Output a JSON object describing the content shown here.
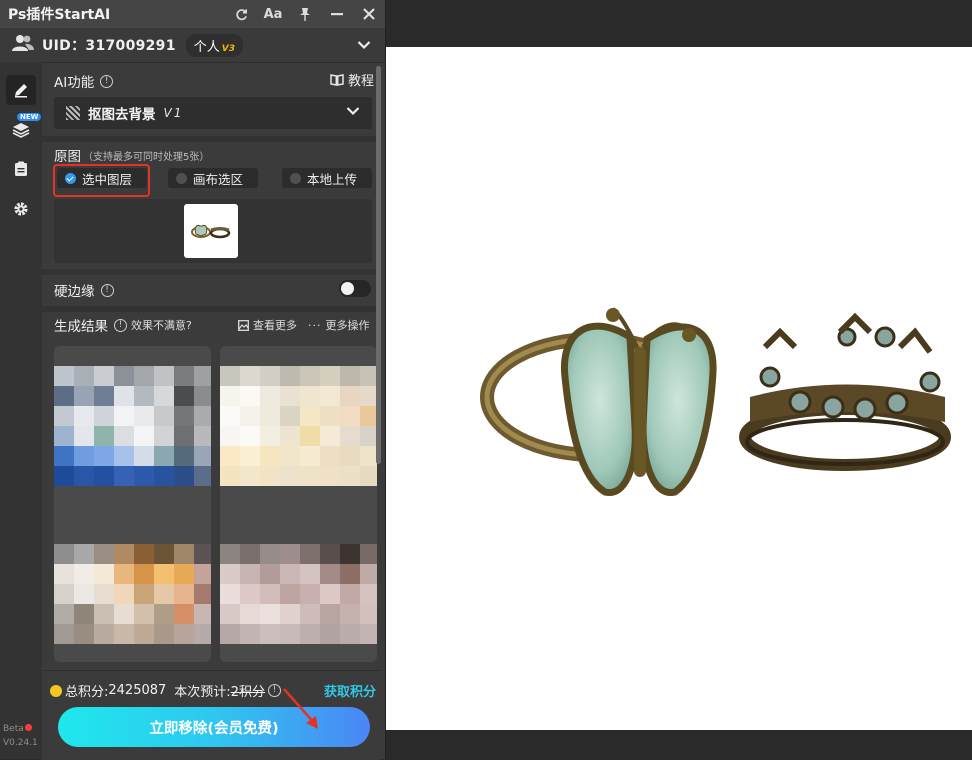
{
  "app": {
    "title": "Ps插件StartAI"
  },
  "titlebar": {
    "icons": [
      "refresh-icon",
      "font-size-icon",
      "pin-icon",
      "minimize-icon",
      "close-icon"
    ],
    "font_label": "Aa"
  },
  "user": {
    "uid": "UID：317009291",
    "plan": "个人",
    "plan_version": "V3"
  },
  "sidebar": {
    "new_tag": "NEW",
    "beta": "Beta",
    "version": "V0.24.1"
  },
  "ai_section": {
    "label": "AI功能",
    "tutorial": "教程",
    "selected_function": "抠图去背景",
    "function_version": "V1"
  },
  "original": {
    "label": "原图",
    "hint": "（支持最多可同时处理5张）",
    "options": [
      "选中图层",
      "画布选区",
      "本地上传"
    ],
    "selected_index": 0
  },
  "hard_edge": {
    "label": "硬边缘",
    "enabled": false
  },
  "results": {
    "label": "生成结果",
    "unsatisfied": "效果不满意?",
    "view_more": "查看更多",
    "more_actions": "更多操作"
  },
  "footer": {
    "total_points_label": "总积分:",
    "total_points": "2425087",
    "estimate_label": "本次预计:",
    "estimate_value": "2积分",
    "get_points": "获取积分",
    "action_button": "立即移除(会员免费)"
  },
  "colors": {
    "accent": "#33c6e4",
    "button_start": "#1fe8ec",
    "button_end": "#4a86f5",
    "highlight": "#e53226"
  }
}
